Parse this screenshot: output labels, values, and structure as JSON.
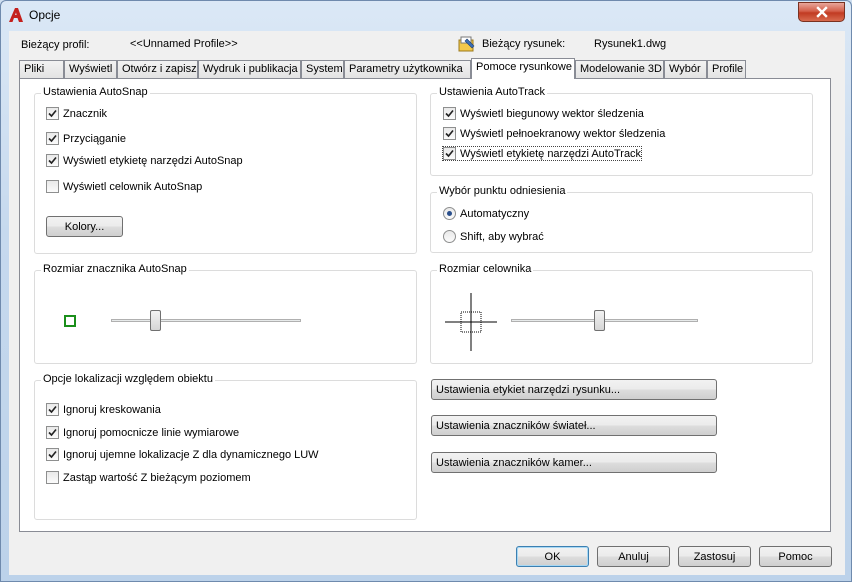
{
  "window": {
    "title": "Opcje"
  },
  "header": {
    "profile_label": "Bieżący profil:",
    "profile_value": "<<Unnamed Profile>>",
    "drawing_label": "Bieżący rysunek:",
    "drawing_value": "Rysunek1.dwg"
  },
  "tabs": [
    {
      "label": "Pliki"
    },
    {
      "label": "Wyświetl"
    },
    {
      "label": "Otwórz i zapisz"
    },
    {
      "label": "Wydruk i publikacja"
    },
    {
      "label": "System"
    },
    {
      "label": "Parametry użytkownika"
    },
    {
      "label": "Pomoce rysunkowe",
      "active": true
    },
    {
      "label": "Modelowanie 3D"
    },
    {
      "label": "Wybór"
    },
    {
      "label": "Profile"
    }
  ],
  "autosnap": {
    "title": "Ustawienia AutoSnap",
    "options": [
      {
        "label": "Znacznik",
        "checked": true
      },
      {
        "label": "Przyciąganie",
        "checked": true
      },
      {
        "label": "Wyświetl etykietę narzędzi AutoSnap",
        "checked": true
      },
      {
        "label": "Wyświetl celownik AutoSnap",
        "checked": false
      }
    ],
    "colors_button": "Kolory..."
  },
  "autotrack": {
    "title": "Ustawienia AutoTrack",
    "options": [
      {
        "label": "Wyświetl biegunowy wektor śledzenia",
        "checked": true
      },
      {
        "label": "Wyświetl pełnoekranowy wektor śledzenia",
        "checked": true
      },
      {
        "label": "Wyświetl etykietę narzędzi AutoTrack",
        "checked": true
      }
    ]
  },
  "alignment": {
    "title": "Wybór punktu odniesienia",
    "options": [
      {
        "label": "Automatyczny",
        "selected": true
      },
      {
        "label": "Shift, aby wybrać",
        "selected": false
      }
    ]
  },
  "marker_size": {
    "title": "Rozmiar znacznika AutoSnap",
    "value_fraction": 0.23,
    "marker_color": "#1b8f1b"
  },
  "aperture_size": {
    "title": "Rozmiar celownika",
    "value_fraction": 0.47
  },
  "object_snap": {
    "title": "Opcje lokalizacji względem obiektu",
    "options": [
      {
        "label": "Ignoruj kreskowania",
        "checked": true
      },
      {
        "label": "Ignoruj pomocnicze linie wymiarowe",
        "checked": true
      },
      {
        "label": "Ignoruj ujemne lokalizacje Z dla dynamicznego LUW",
        "checked": true
      },
      {
        "label": "Zastąp wartość Z bieżącym poziomem",
        "checked": false
      }
    ]
  },
  "side_buttons": [
    {
      "label": "Ustawienia etykiet narzędzi rysunku..."
    },
    {
      "label": "Ustawienia znaczników świateł..."
    },
    {
      "label": "Ustawienia znaczników kamer..."
    }
  ],
  "footer": {
    "ok": "OK",
    "cancel": "Anuluj",
    "apply": "Zastosuj",
    "help": "Pomoc"
  },
  "colors": {
    "app_icon": "#c4201d",
    "accent": "#3c7fb1",
    "close": "#c13b22"
  }
}
